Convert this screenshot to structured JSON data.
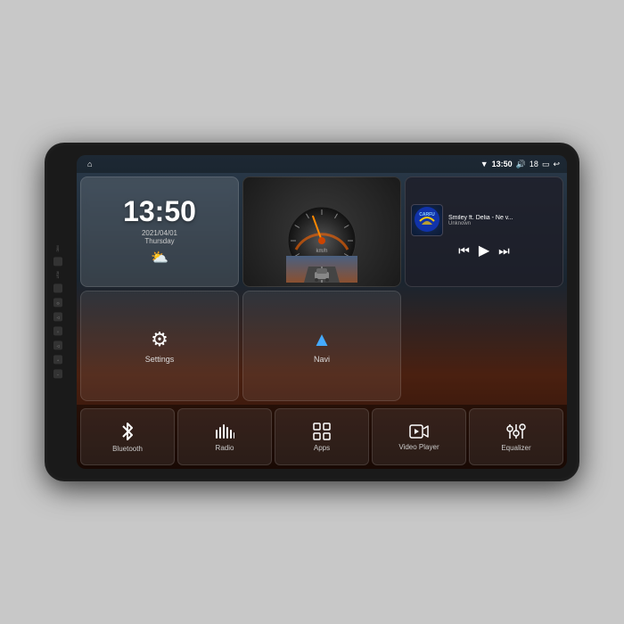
{
  "device": {
    "side_labels": [
      "MIC",
      "RST"
    ]
  },
  "status_bar": {
    "time": "13:50",
    "signal": "▼18",
    "wifi": "WiFi",
    "volume": "🔊",
    "battery": "🔋",
    "back": "↩"
  },
  "clock_widget": {
    "time": "13:50",
    "date": "2021/04/01",
    "day": "Thursday",
    "weather": "⛅"
  },
  "music_widget": {
    "title": "Smiley ft. Delia - Ne v...",
    "artist": "Unknown",
    "logo": "CARFU",
    "prev": "⏮",
    "play": "▶",
    "next": "⏭"
  },
  "speedo_widget": {
    "speed_unit": "km/h",
    "needle_angle": -20
  },
  "actions": [
    {
      "id": "settings",
      "icon": "⚙",
      "label": "Settings"
    },
    {
      "id": "navi",
      "icon": "▲",
      "label": "Navi"
    }
  ],
  "bottom_buttons": [
    {
      "id": "bluetooth",
      "label": "Bluetooth",
      "icon": "bluetooth"
    },
    {
      "id": "radio",
      "label": "Radio",
      "icon": "radio"
    },
    {
      "id": "apps",
      "label": "Apps",
      "icon": "apps"
    },
    {
      "id": "video-player",
      "label": "Video Player",
      "icon": "video"
    },
    {
      "id": "equalizer",
      "label": "Equalizer",
      "icon": "equalizer"
    }
  ],
  "colors": {
    "accent": "#4af",
    "bg_dark": "#1a1a2e",
    "panel_bg": "rgba(255,255,255,0.08)"
  }
}
